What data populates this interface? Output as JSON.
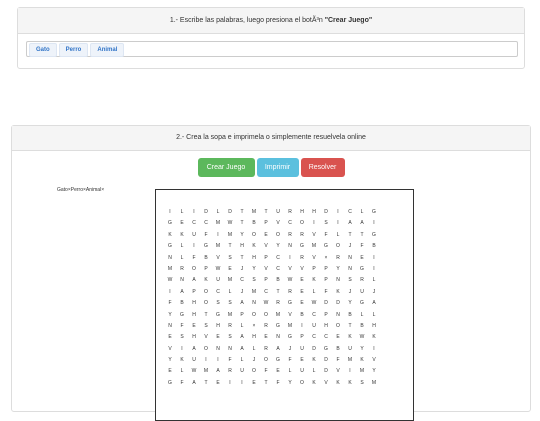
{
  "step1": {
    "heading_text": "1.- Escribe las palabras, luego presiona el botÃ³n ",
    "heading_bold": "\"Crear Juego\"",
    "tags": [
      "Gato",
      "Perro",
      "Animal"
    ]
  },
  "step2": {
    "heading": "2.- Crea la sopa e imprimela o simplemente resuelvela online",
    "buttons": {
      "create": "Crear Juego",
      "print": "Imprimir",
      "solve": "Resolver"
    },
    "word_list": "Gato×Perro×Animal×",
    "grid": [
      "ILIDLDTMTURHHDICLG",
      "GECCMWTBPVCOISIAAI",
      "KKUFIMYOEORRVFLTTG",
      "GLIGMTHKVYNGMGOJFB",
      "NLFBVSTHPCIRV×RNEI",
      "MROPWEJYVCVVPPYNGI",
      "WNAKUMCSPBWEKPNSRL",
      "IAPOCLJMCTRELFKJUJ",
      "FBHOSSANWRGEWDDYGA",
      "YGHTGMPOOMVBCPNBLL",
      "NFESHRL×RGMIUHOTBH",
      "ESHVESAHENGPCCEKWK",
      "VIAONNALRAJUDGBUYI",
      "YKUIIFLJOGFEKDFMKV",
      "ELWMARUOFELULDVIMY",
      "GFATEIIETFYOKVKKSM"
    ]
  }
}
